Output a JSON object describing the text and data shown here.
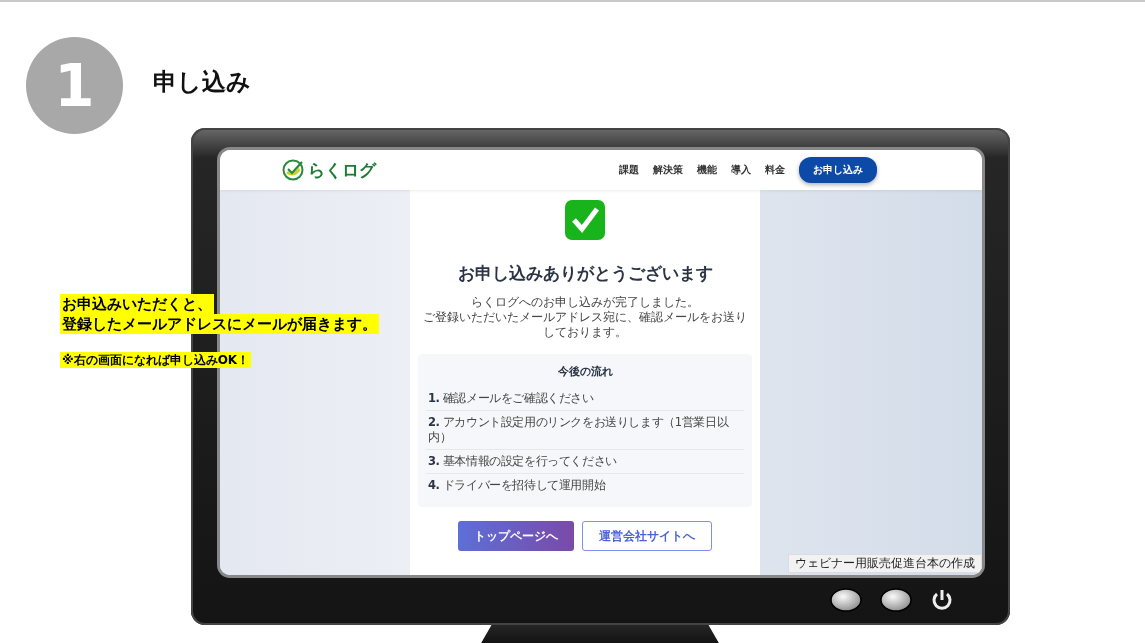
{
  "step": {
    "number": "1",
    "title": "申し込み"
  },
  "note": {
    "lines": [
      "お申込みいただくと、",
      "登録したメールアドレスにメールが届きます。"
    ],
    "remark": "※右の画面になれば申し込みOK！"
  },
  "site": {
    "logo": "らくログ",
    "nav": [
      "課題",
      "解決策",
      "機能",
      "導入",
      "料金"
    ],
    "cta": "お申し込み",
    "heading": "お申し込みありがとうございます",
    "message": [
      "らくログへのお申し込みが完了しました。",
      "ご登録いただいたメールアドレス宛に、確認メールをお送りしております。"
    ],
    "flow": {
      "title": "今後の流れ",
      "steps": [
        "**1.** 確認メールをご確認ください",
        "**2.** アカウント設定用のリンクをお送りします（1営業日以内）",
        "**3.** 基本情報の設定を行ってください",
        "**4.** ドライバーを招待して運用開始"
      ]
    },
    "buttons": [
      {
        "label": "トップページへ",
        "kind": "primary"
      },
      {
        "label": "運営会社サイトへ",
        "kind": "secondary"
      }
    ],
    "toast": "ウェビナー用販売促進台本の作成"
  }
}
